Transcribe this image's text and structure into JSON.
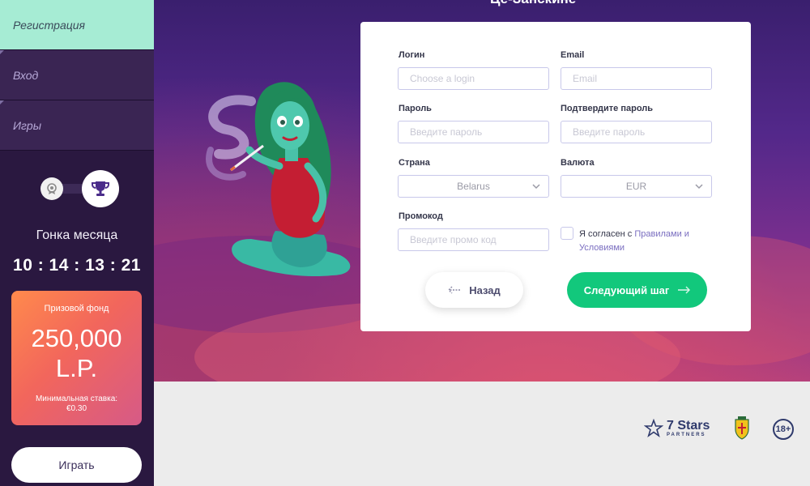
{
  "sidebar": {
    "nav": [
      {
        "label": "Регистрация"
      },
      {
        "label": "Вход"
      },
      {
        "label": "Игры"
      }
    ],
    "race_title": "Гонка месяца",
    "timer": "10 : 14 : 13 : 21",
    "prize": {
      "label": "Призовой фонд",
      "amount_line1": "250,000",
      "amount_line2": "L.P.",
      "min_bet_line1": "Минимальная ставка:",
      "min_bet_line2": "€0.30"
    },
    "play_label": "Играть"
  },
  "hero": {
    "title": "Це-Занскине"
  },
  "form": {
    "login_label": "Логин",
    "login_placeholder": "Choose a login",
    "email_label": "Email",
    "email_placeholder": "Email",
    "password_label": "Пароль",
    "password_placeholder": "Введите пароль",
    "confirm_label": "Подтвердите пароль",
    "confirm_placeholder": "Введите пароль",
    "country_label": "Страна",
    "country_value": "Belarus",
    "currency_label": "Валюта",
    "currency_value": "EUR",
    "promo_label": "Промокод",
    "promo_placeholder": "Введите промо код",
    "agree_prefix": "Я согласен с ",
    "agree_link_1": "Правилами и",
    "agree_link_2": "Условиями",
    "back_label": "Назад",
    "next_label": "Следующий шаг"
  },
  "footer": {
    "partners_name": "7 Stars",
    "partners_sub": "PARTNERS",
    "age_badge": "18+"
  },
  "colors": {
    "accent_green": "#12c87c",
    "nav_active": "#a6ecd4",
    "sidebar_bg": "#2a1840"
  }
}
